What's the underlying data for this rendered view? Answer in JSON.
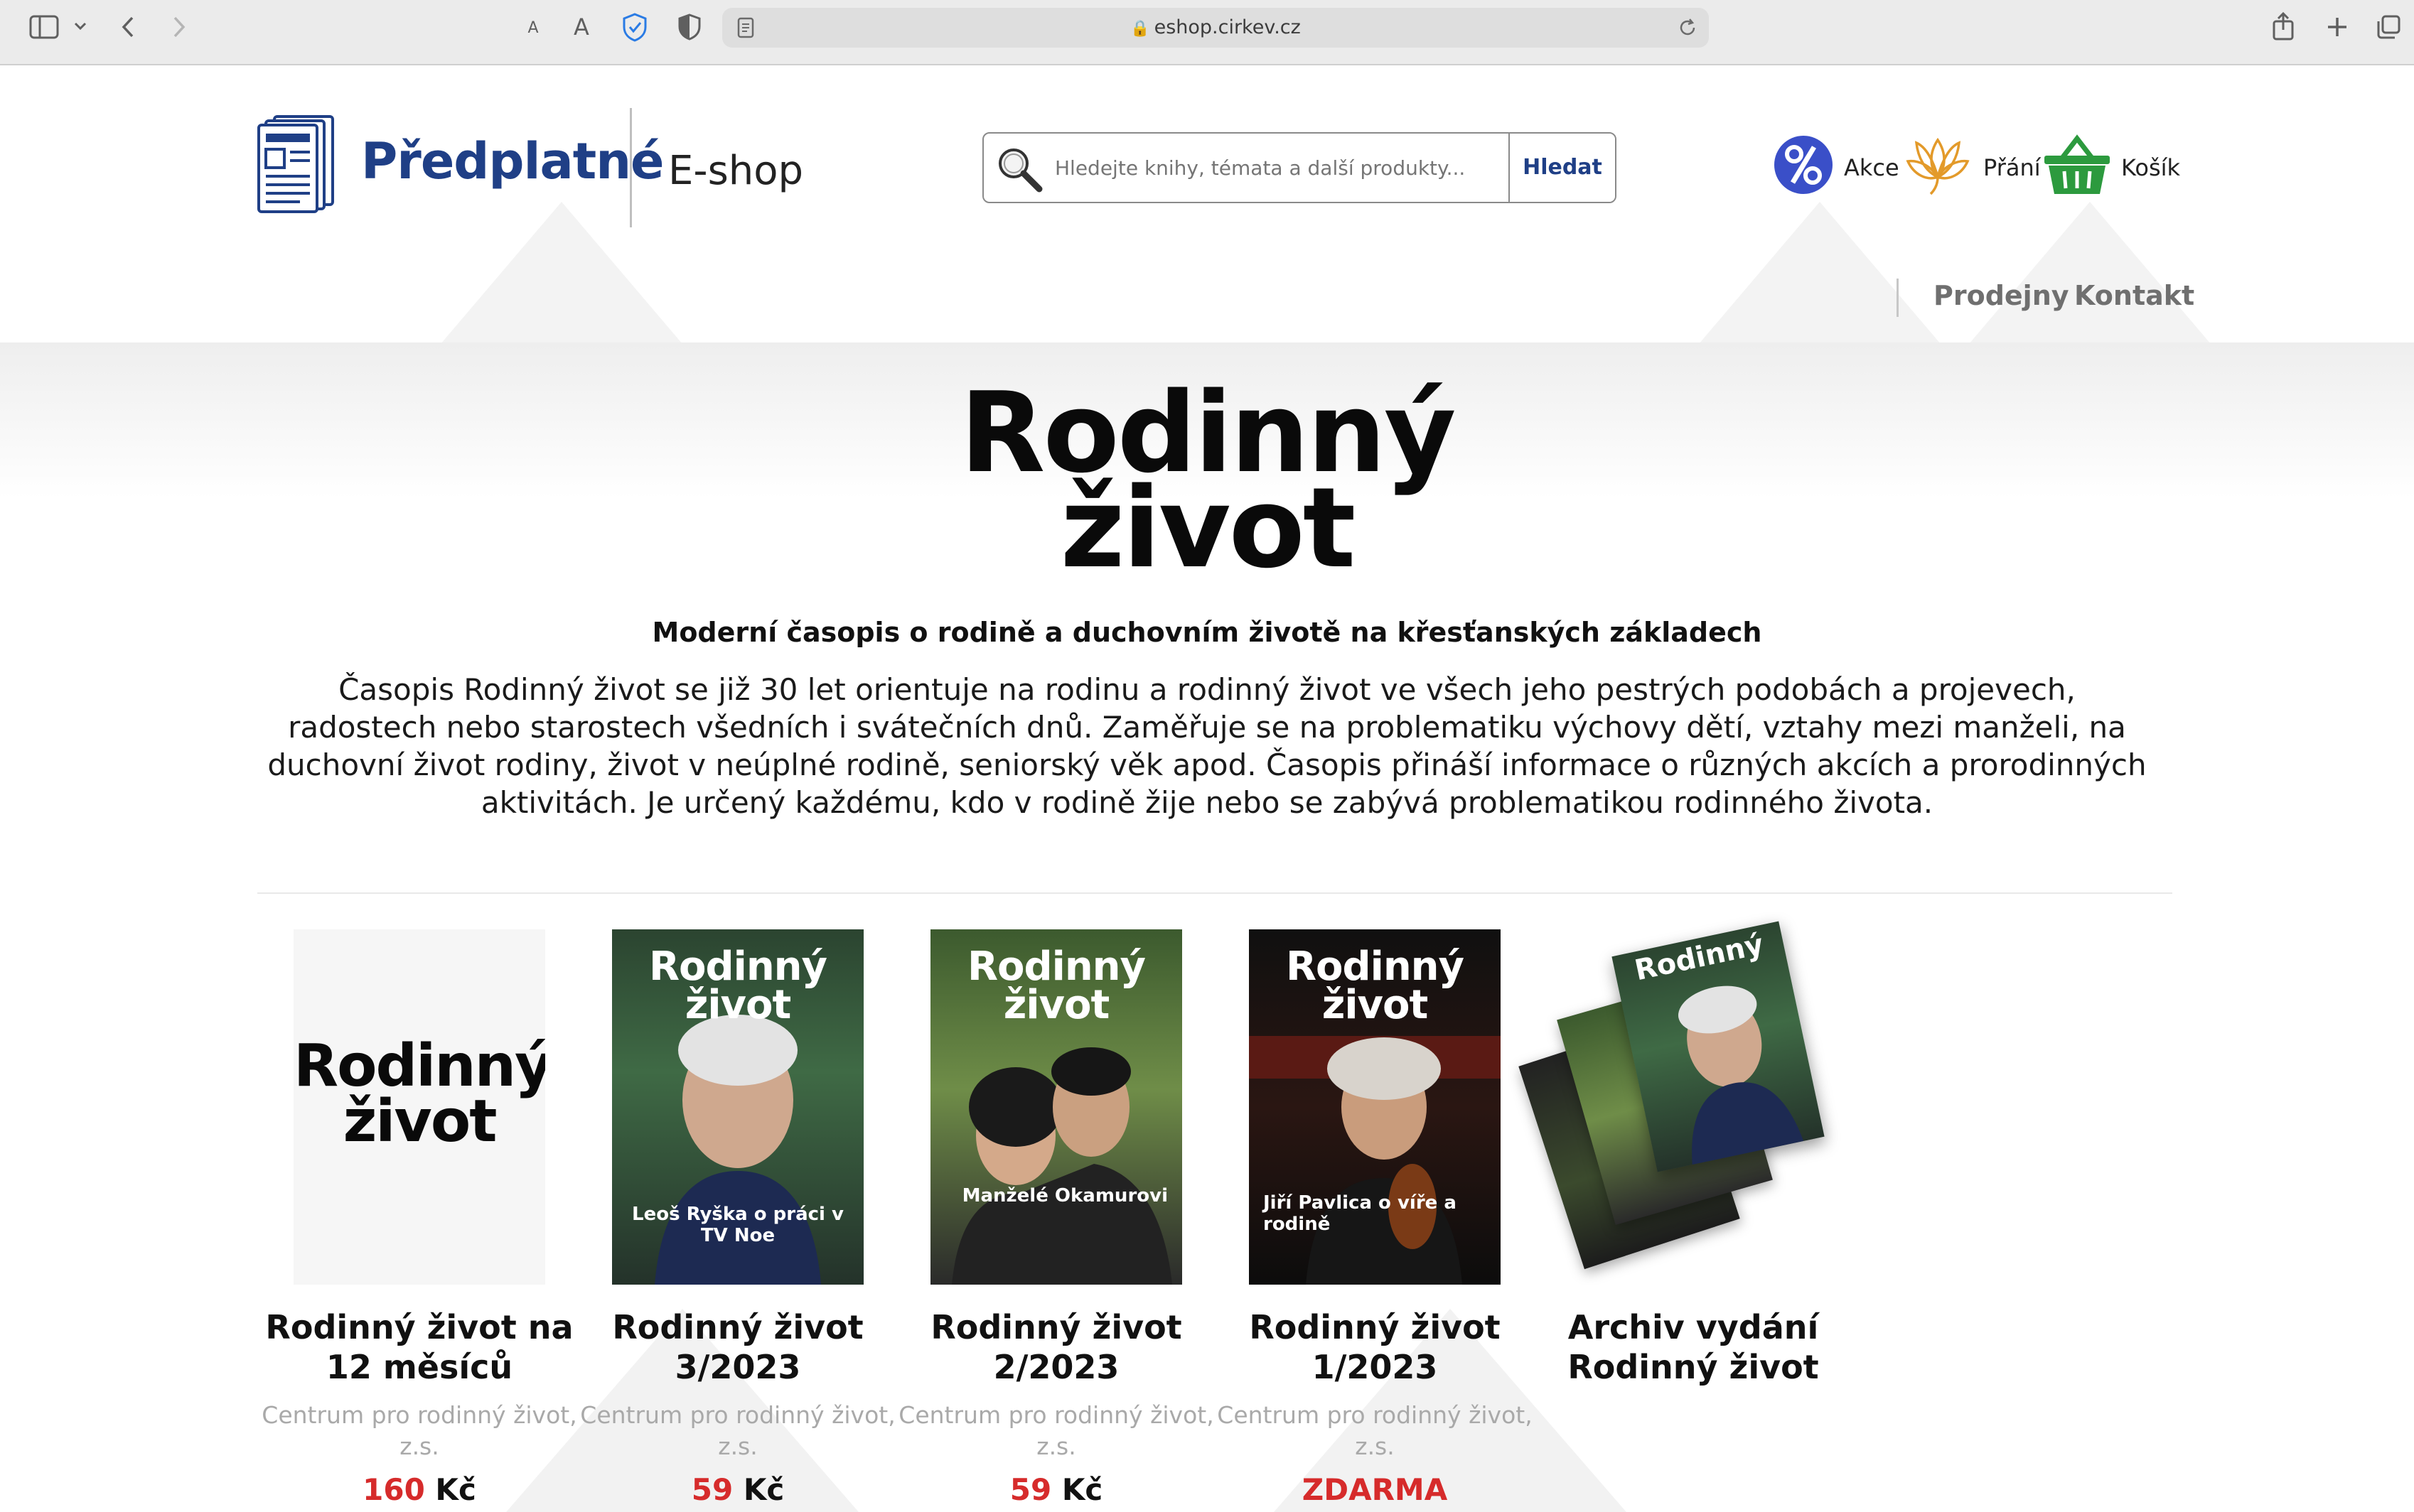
{
  "browser": {
    "url": "eshop.cirkev.cz",
    "font_small": "A",
    "font_large": "A"
  },
  "header": {
    "logo_title": "Předplatné",
    "logo_subtitle": "E-shop",
    "search": {
      "placeholder": "Hledejte knihy, témata a další produkty...",
      "button": "Hledat"
    },
    "links": [
      {
        "label": "Akce",
        "icon": "percent-icon"
      },
      {
        "label": "Přání",
        "icon": "flower-icon"
      },
      {
        "label": "Košík",
        "icon": "basket-icon"
      }
    ],
    "nav": [
      "Prodejny",
      "Kontakt"
    ]
  },
  "main": {
    "title_line1": "Rodinný",
    "title_line2": "život",
    "subtitle": "Moderní časopis o rodině a duchovním životě na křesťanských základech",
    "description": "Časopis Rodinný život se již 30 let orientuje na rodinu a rodinný život ve všech jeho pestrých podobách a projevech, radostech nebo starostech všedních i svátečních dnů. Zaměřuje se na problematiku výchovy dětí, vztahy mezi manželi, na duchovní život rodiny, život v neúplné rodině, seniorský věk apod. Časopis přináší informace o různých akcích a prorodinných aktivitách. Je určený každému, kdo v rodině žije nebo se zabývá problematikou rodinného života."
  },
  "products": [
    {
      "title": "Rodinný život na 12 měsíců",
      "publisher": "Centrum pro rodinný život, z.s.",
      "price": "160",
      "currency": "Kč",
      "cover_text_1": "Rodinný",
      "cover_text_2": "život"
    },
    {
      "title": "Rodinný život 3/2023",
      "publisher": "Centrum pro rodinný život, z.s.",
      "price": "59",
      "currency": "Kč",
      "cover_caption": "Leoš Ryška o práci v TV Noe"
    },
    {
      "title": "Rodinný život 2/2023",
      "publisher": "Centrum pro rodinný život, z.s.",
      "price": "59",
      "currency": "Kč",
      "cover_caption": "Manželé Okamurovi"
    },
    {
      "title": "Rodinný život 1/2023",
      "publisher": "Centrum pro rodinný život, z.s.",
      "price": "ZDARMA",
      "currency": "",
      "cover_caption": "Jiří Pavlica o víře a rodině"
    },
    {
      "title": "Archiv vydání Rodinný život",
      "publisher": "",
      "price": "",
      "currency": ""
    }
  ],
  "colors": {
    "brand": "#1f3f86",
    "price": "#d62b2b",
    "basket": "#2c9a3e",
    "percent": "#3a4fc8",
    "flower": "#e39a2a"
  }
}
